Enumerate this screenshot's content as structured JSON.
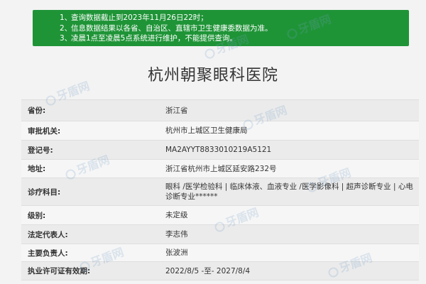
{
  "notice": {
    "lines": [
      {
        "num": "1、",
        "text": "查询数据截止到2023年11月26日22时；"
      },
      {
        "num": "2、",
        "text": "信息数据结果以各省、自治区、直辖市卫生健康委数据为准。"
      },
      {
        "num": "3、",
        "text": "凌晨1点至凌晨5点系统进行维护，不能提供查询。"
      }
    ]
  },
  "hospital": {
    "name": "杭州朝聚眼科医院"
  },
  "rows": [
    {
      "label": "省份:",
      "value": "浙江省"
    },
    {
      "label": "审批机关:",
      "value": "杭州市上城区卫生健康局"
    },
    {
      "label": "登记号:",
      "value": "MA2AYYT8833010219A5121"
    },
    {
      "label": "地址:",
      "value": "浙江省杭州市上城区延安路232号"
    },
    {
      "label": "诊疗科目:",
      "value": "眼科 /医学检验科 | 临床体液、血液专业 /医学影像科 | 超声诊断专业 | 心电诊断专业******"
    },
    {
      "label": "级别:",
      "value": "未定级"
    },
    {
      "label": "法定代表人:",
      "value": "李志伟"
    },
    {
      "label": "主要负责人:",
      "value": "张波洲"
    },
    {
      "label": "执业许可证有效期:",
      "value": "2022/8/5 -至- 2027/8/4"
    }
  ],
  "watermark": {
    "text": "牙盾网"
  }
}
